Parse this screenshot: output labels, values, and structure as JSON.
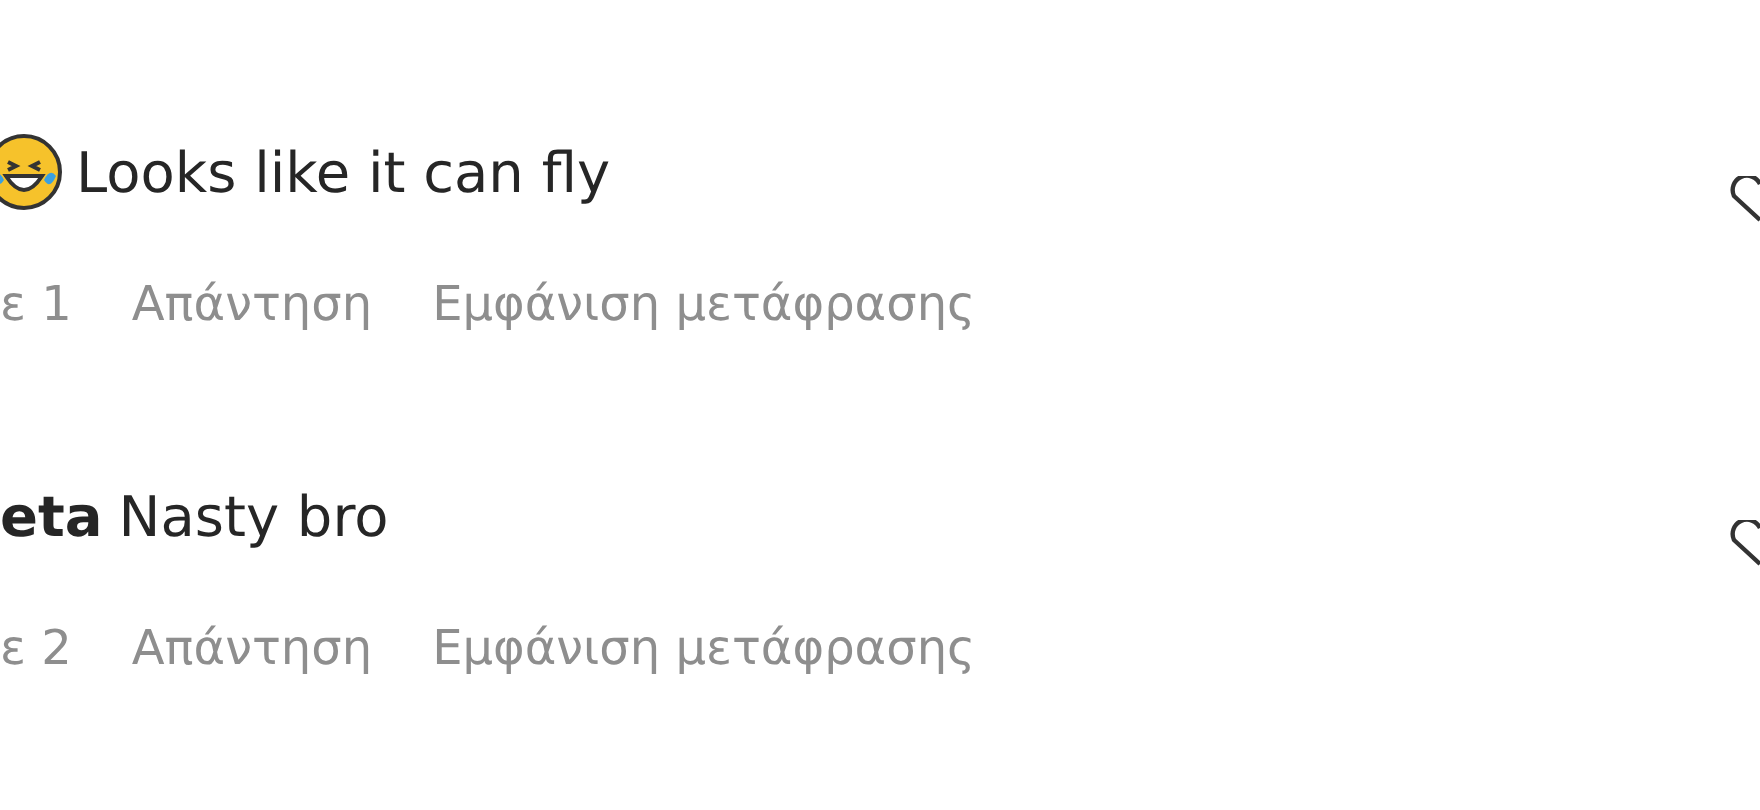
{
  "comments": [
    {
      "kind": "emoji",
      "text": "Looks like it can fly",
      "liked": false,
      "likes": "ε 1",
      "reply": "Απάντηση",
      "translate": "Εμφάνιση μετάφρασης"
    },
    {
      "kind": "user",
      "username": "eta",
      "text": "Nasty bro",
      "liked": false,
      "likes": "ε 2",
      "reply": "Απάντηση",
      "translate": "Εμφάνιση μετάφρασης"
    }
  ]
}
